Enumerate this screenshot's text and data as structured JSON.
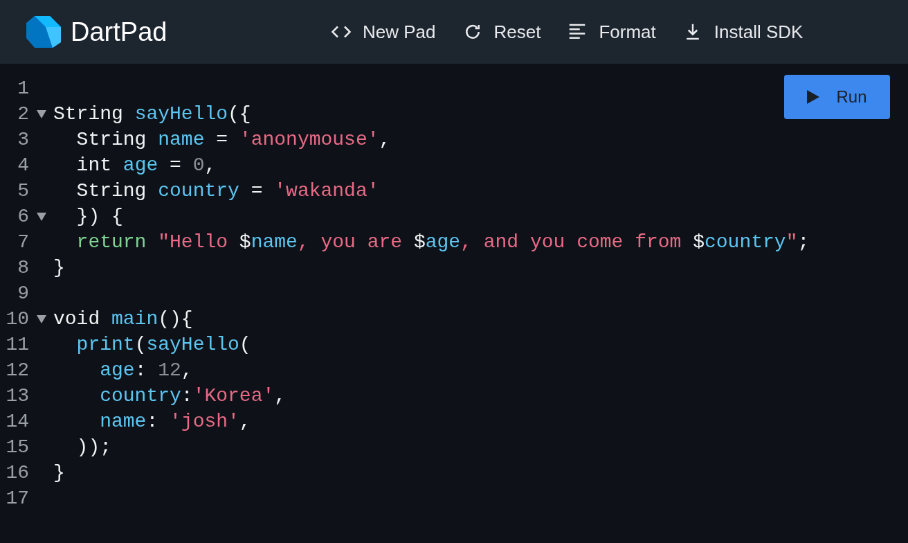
{
  "header": {
    "title": "DartPad",
    "actions": [
      {
        "kind": "code",
        "label": "New Pad"
      },
      {
        "kind": "reset",
        "label": "Reset"
      },
      {
        "kind": "format",
        "label": "Format"
      },
      {
        "kind": "download",
        "label": "Install SDK"
      }
    ]
  },
  "run_button": {
    "label": "Run"
  },
  "editor": {
    "lines": [
      {
        "number": "1",
        "foldable": false
      },
      {
        "number": "2",
        "foldable": true,
        "tokens": [
          {
            "kind": "plain",
            "text": "String "
          },
          {
            "kind": "ident",
            "text": "sayHello"
          },
          {
            "kind": "plain",
            "text": "({"
          }
        ]
      },
      {
        "number": "3",
        "foldable": false,
        "tokens": [
          {
            "kind": "plain",
            "text": "  String "
          },
          {
            "kind": "ident",
            "text": "name"
          },
          {
            "kind": "plain",
            "text": " = "
          },
          {
            "kind": "string",
            "text": "'anonymouse'"
          },
          {
            "kind": "plain",
            "text": ","
          }
        ]
      },
      {
        "number": "4",
        "foldable": false,
        "tokens": [
          {
            "kind": "plain",
            "text": "  int "
          },
          {
            "kind": "ident",
            "text": "age"
          },
          {
            "kind": "plain",
            "text": " = "
          },
          {
            "kind": "number",
            "text": "0"
          },
          {
            "kind": "plain",
            "text": ","
          }
        ]
      },
      {
        "number": "5",
        "foldable": false,
        "tokens": [
          {
            "kind": "plain",
            "text": "  String "
          },
          {
            "kind": "ident",
            "text": "country"
          },
          {
            "kind": "plain",
            "text": " = "
          },
          {
            "kind": "string",
            "text": "'wakanda'"
          }
        ]
      },
      {
        "number": "6",
        "foldable": true,
        "tokens": [
          {
            "kind": "plain",
            "text": "  }) {"
          }
        ]
      },
      {
        "number": "7",
        "foldable": false,
        "tokens": [
          {
            "kind": "keyword",
            "text": "  return"
          },
          {
            "kind": "string",
            "text": " \"Hello "
          },
          {
            "kind": "plain",
            "text": "$"
          },
          {
            "kind": "ident",
            "text": "name"
          },
          {
            "kind": "string",
            "text": ", you are "
          },
          {
            "kind": "plain",
            "text": "$"
          },
          {
            "kind": "ident",
            "text": "age"
          },
          {
            "kind": "string",
            "text": ", and you come from "
          },
          {
            "kind": "plain",
            "text": "$"
          },
          {
            "kind": "ident",
            "text": "country"
          },
          {
            "kind": "string",
            "text": "\""
          },
          {
            "kind": "plain",
            "text": ";"
          }
        ]
      },
      {
        "number": "8",
        "foldable": false,
        "tokens": [
          {
            "kind": "plain",
            "text": "}"
          }
        ]
      },
      {
        "number": "9",
        "foldable": false
      },
      {
        "number": "10",
        "foldable": true,
        "tokens": [
          {
            "kind": "plain",
            "text": "void "
          },
          {
            "kind": "ident",
            "text": "main"
          },
          {
            "kind": "plain",
            "text": "(){"
          }
        ]
      },
      {
        "number": "11",
        "foldable": false,
        "tokens": [
          {
            "kind": "ident",
            "text": "  print"
          },
          {
            "kind": "plain",
            "text": "("
          },
          {
            "kind": "ident",
            "text": "sayHello"
          },
          {
            "kind": "plain",
            "text": "("
          }
        ]
      },
      {
        "number": "12",
        "foldable": false,
        "tokens": [
          {
            "kind": "ident",
            "text": "    age"
          },
          {
            "kind": "plain",
            "text": ": "
          },
          {
            "kind": "number",
            "text": "12"
          },
          {
            "kind": "plain",
            "text": ","
          }
        ]
      },
      {
        "number": "13",
        "foldable": false,
        "tokens": [
          {
            "kind": "ident",
            "text": "    country"
          },
          {
            "kind": "plain",
            "text": ":"
          },
          {
            "kind": "string",
            "text": "'Korea'"
          },
          {
            "kind": "plain",
            "text": ","
          }
        ]
      },
      {
        "number": "14",
        "foldable": false,
        "tokens": [
          {
            "kind": "ident",
            "text": "    name"
          },
          {
            "kind": "plain",
            "text": ": "
          },
          {
            "kind": "string",
            "text": "'josh'"
          },
          {
            "kind": "plain",
            "text": ","
          }
        ]
      },
      {
        "number": "15",
        "foldable": false,
        "tokens": [
          {
            "kind": "plain",
            "text": "  ));"
          }
        ]
      },
      {
        "number": "16",
        "foldable": false,
        "tokens": [
          {
            "kind": "plain",
            "text": "}"
          }
        ]
      },
      {
        "number": "17",
        "foldable": false
      }
    ]
  }
}
